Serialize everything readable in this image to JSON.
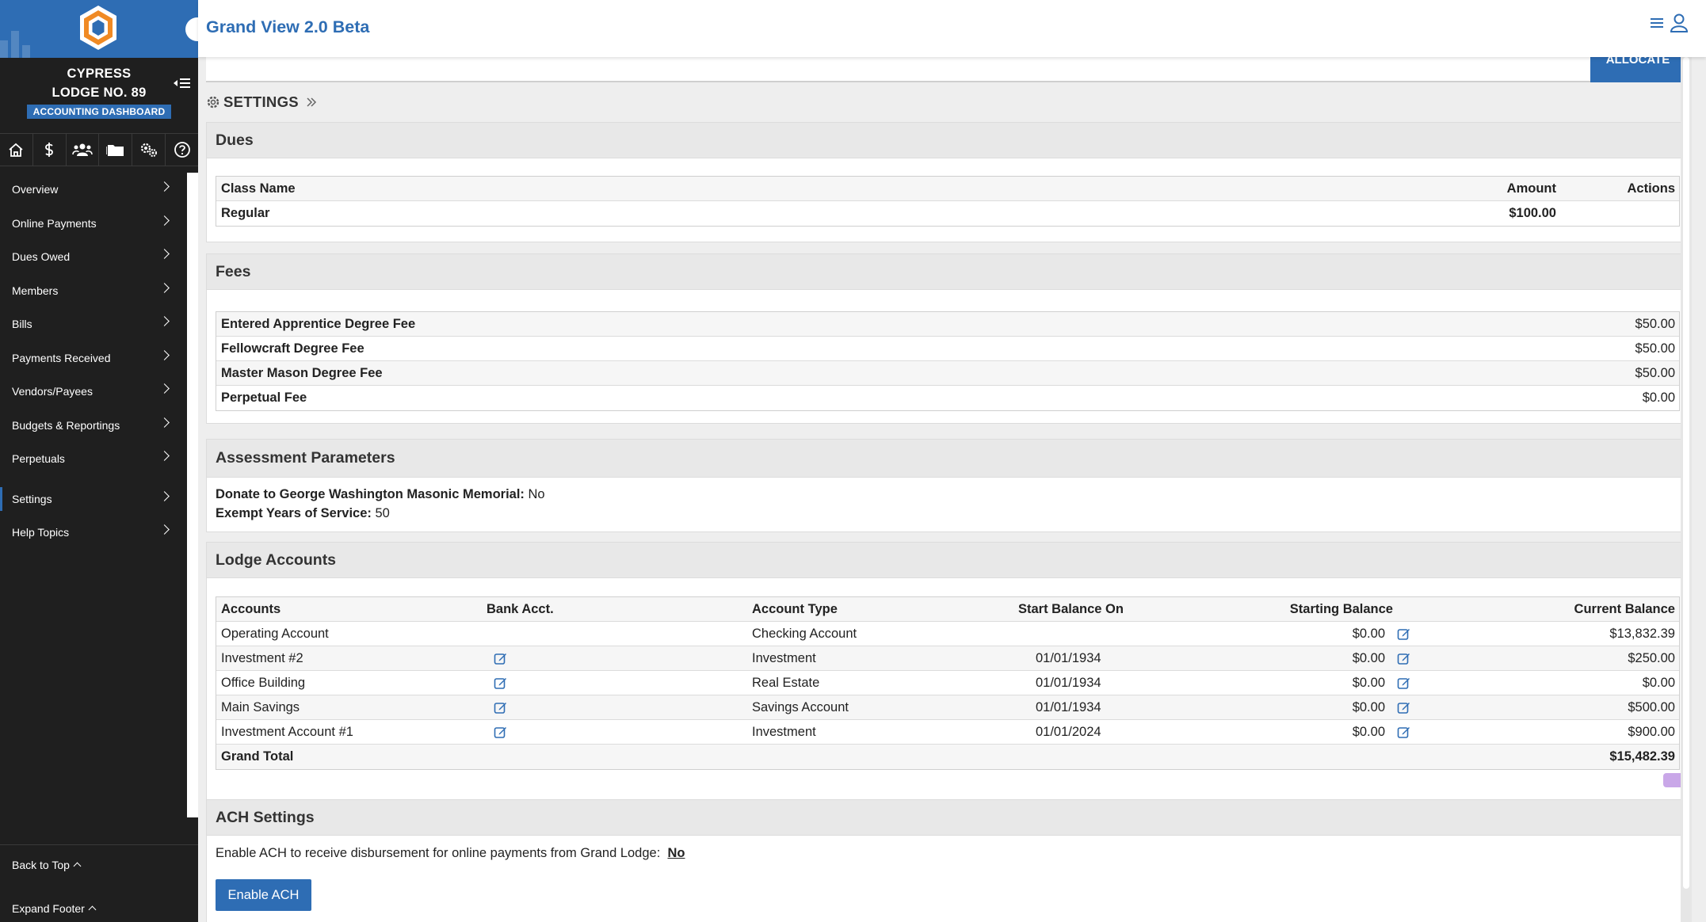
{
  "app": {
    "title": "Grand View 2.0 Beta"
  },
  "lodge": {
    "line1": "CYPRESS",
    "line2": "LODGE NO. 89",
    "badge": "ACCOUNTING DASHBOARD"
  },
  "nav": {
    "items": [
      {
        "label": "Overview"
      },
      {
        "label": "Online Payments"
      },
      {
        "label": "Dues Owed"
      },
      {
        "label": "Members"
      },
      {
        "label": "Bills"
      },
      {
        "label": "Payments Received"
      },
      {
        "label": "Vendors/Payees"
      },
      {
        "label": "Budgets & Reportings"
      },
      {
        "label": "Perpetuals"
      },
      {
        "label": "Settings"
      },
      {
        "label": "Help Topics"
      }
    ],
    "back_to_top": "Back to Top",
    "expand_footer": "Expand Footer"
  },
  "toolbar": {
    "allocate": "ALLOCATE"
  },
  "breadcrumb": {
    "label": "SETTINGS"
  },
  "dues": {
    "title": "Dues",
    "headers": {
      "class_name": "Class Name",
      "amount": "Amount",
      "actions": "Actions"
    },
    "rows": [
      {
        "class_name": "Regular",
        "amount": "$100.00"
      }
    ]
  },
  "fees": {
    "title": "Fees",
    "rows": [
      {
        "name": "Entered Apprentice Degree Fee",
        "amount": "$50.00"
      },
      {
        "name": "Fellowcraft Degree Fee",
        "amount": "$50.00"
      },
      {
        "name": "Master Mason Degree Fee",
        "amount": "$50.00"
      },
      {
        "name": "Perpetual Fee",
        "amount": "$0.00"
      }
    ]
  },
  "assessment": {
    "title": "Assessment Parameters",
    "donate_label": "Donate to George Washington Masonic Memorial:",
    "donate_value": "No",
    "exempt_label": "Exempt Years of Service:",
    "exempt_value": "50"
  },
  "lodge_accounts": {
    "title": "Lodge Accounts",
    "headers": {
      "accounts": "Accounts",
      "bank": "Bank Acct.",
      "type": "Account Type",
      "start_on": "Start Balance On",
      "starting": "Starting Balance",
      "current": "Current Balance"
    },
    "rows": [
      {
        "account": "Operating Account",
        "type": "Checking Account",
        "start_on": "",
        "starting": "$0.00",
        "current": "$13,832.39"
      },
      {
        "account": "Investment #2",
        "type": "Investment",
        "start_on": "01/01/1934",
        "starting": "$0.00",
        "current": "$250.00"
      },
      {
        "account": "Office Building",
        "type": "Real Estate",
        "start_on": "01/01/1934",
        "starting": "$0.00",
        "current": "$0.00"
      },
      {
        "account": "Main Savings",
        "type": "Savings Account",
        "start_on": "01/01/1934",
        "starting": "$0.00",
        "current": "$500.00"
      },
      {
        "account": "Investment Account #1",
        "type": "Investment",
        "start_on": "01/01/2024",
        "starting": "$0.00",
        "current": "$900.00"
      }
    ],
    "total_label": "Grand Total",
    "total_value": "$15,482.39"
  },
  "ach": {
    "title": "ACH Settings",
    "text": "Enable ACH to receive disbursement for online payments from Grand Lodge:",
    "value": "No",
    "button": "Enable ACH"
  },
  "colors": {
    "brand": "#2e6db4",
    "logo_orange": "#f08a24",
    "sidebar": "#1f1f1f"
  }
}
